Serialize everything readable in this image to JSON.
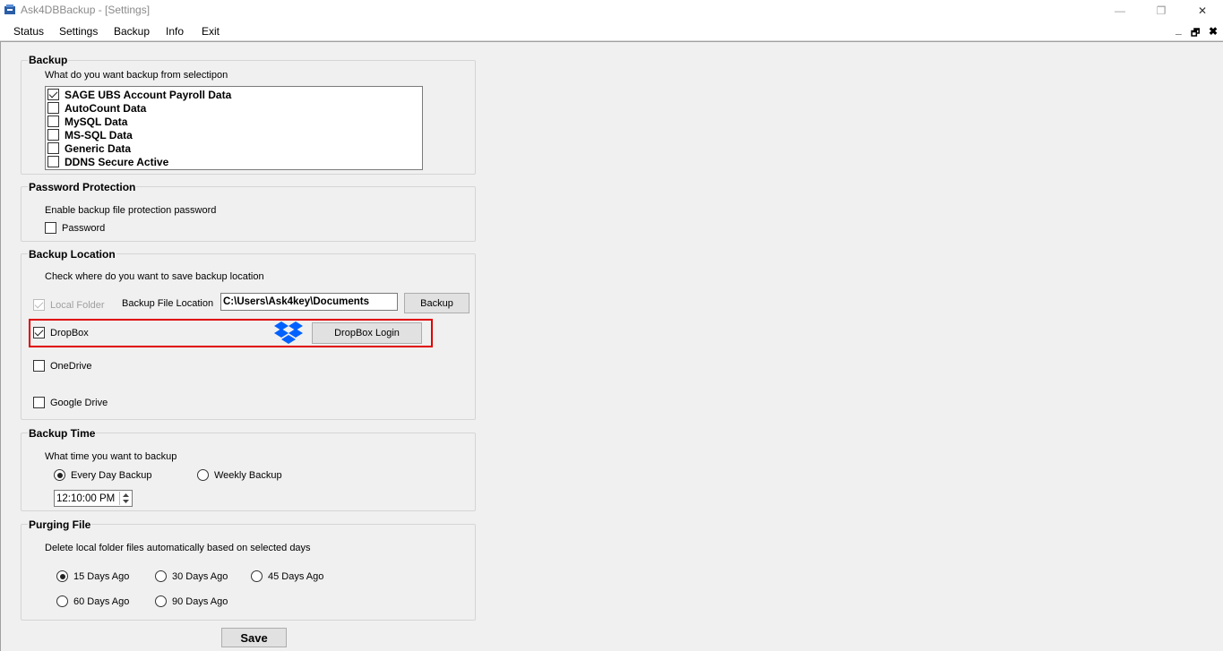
{
  "window": {
    "title": "Ask4DBBackup - [Settings]",
    "minimize_glyph": "—",
    "restore_glyph": "❐",
    "close_glyph": "✕"
  },
  "menu": {
    "items": [
      "Status",
      "Settings",
      "Backup",
      "Info",
      "Exit"
    ],
    "mdi_minimize": "_",
    "mdi_restore": "🗗",
    "mdi_close": "✖"
  },
  "backup": {
    "title": "Backup",
    "prompt": "What do you want backup from selectipon",
    "options": [
      {
        "label": "SAGE UBS Account Payroll Data",
        "checked": true
      },
      {
        "label": "AutoCount Data",
        "checked": false
      },
      {
        "label": "MySQL Data",
        "checked": false
      },
      {
        "label": "MS-SQL Data",
        "checked": false
      },
      {
        "label": "Generic Data",
        "checked": false
      },
      {
        "label": "DDNS Secure Active",
        "checked": false
      }
    ]
  },
  "password": {
    "title": "Password Protection",
    "prompt": "Enable backup file protection password",
    "checkbox_label": "Password",
    "checked": false
  },
  "location": {
    "title": "Backup Location",
    "prompt": "Check  where do you want to save backup location",
    "local_folder_label": "Local Folder",
    "local_folder_checked": true,
    "file_location_label": "Backup File Location",
    "file_location_value": "C:\\Users\\Ask4key\\Documents",
    "backup_button": "Backup",
    "dropbox_label": "DropBox",
    "dropbox_checked": true,
    "dropbox_login_button": "DropBox Login",
    "onedrive_label": "OneDrive",
    "onedrive_checked": false,
    "googledrive_label": "Google Drive",
    "googledrive_checked": false
  },
  "time": {
    "title": "Backup Time",
    "prompt": "What time you want to backup",
    "every_day_label": "Every Day Backup",
    "weekly_label": "Weekly Backup",
    "selected": "every_day",
    "time_value": "12:10:00 PM"
  },
  "purging": {
    "title": "Purging File",
    "prompt": "Delete local folder files automatically based on selected days",
    "options": [
      "15 Days Ago",
      "30 Days Ago",
      "45 Days Ago",
      "60 Days Ago",
      "90 Days Ago"
    ],
    "selected": "15 Days Ago"
  },
  "save_button": "Save",
  "colors": {
    "highlight": "#e00000",
    "dropbox_blue": "#0061fe"
  }
}
